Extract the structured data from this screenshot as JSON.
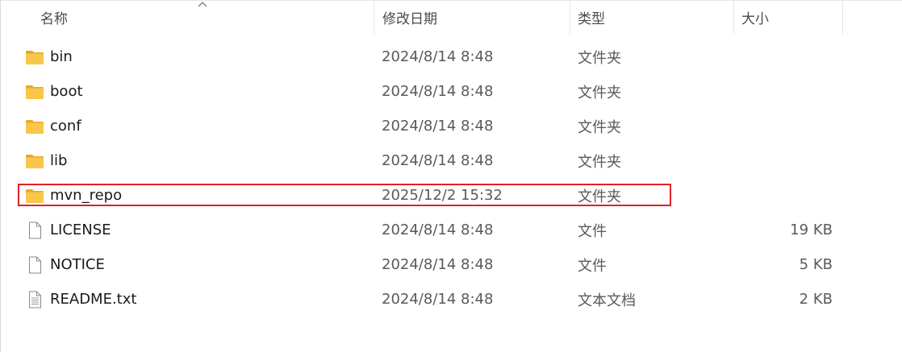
{
  "columns": {
    "name": "名称",
    "modified": "修改日期",
    "type": "类型",
    "size": "大小"
  },
  "files": [
    {
      "name": "bin",
      "modified": "2024/8/14 8:48",
      "type": "文件夹",
      "size": "",
      "icon": "folder-icon"
    },
    {
      "name": "boot",
      "modified": "2024/8/14 8:48",
      "type": "文件夹",
      "size": "",
      "icon": "folder-icon"
    },
    {
      "name": "conf",
      "modified": "2024/8/14 8:48",
      "type": "文件夹",
      "size": "",
      "icon": "folder-icon"
    },
    {
      "name": "lib",
      "modified": "2024/8/14 8:48",
      "type": "文件夹",
      "size": "",
      "icon": "folder-icon"
    },
    {
      "name": "mvn_repo",
      "modified": "2025/12/2 15:32",
      "type": "文件夹",
      "size": "",
      "icon": "folder-icon",
      "highlighted": true
    },
    {
      "name": "LICENSE",
      "modified": "2024/8/14 8:48",
      "type": "文件",
      "size": "19 KB",
      "icon": "file-icon"
    },
    {
      "name": "NOTICE",
      "modified": "2024/8/14 8:48",
      "type": "文件",
      "size": "5 KB",
      "icon": "file-icon"
    },
    {
      "name": "README.txt",
      "modified": "2024/8/14 8:48",
      "type": "文本文档",
      "size": "2 KB",
      "icon": "text-file-icon"
    }
  ],
  "colors": {
    "highlight": "#e0202a",
    "folder": "#f8c74a"
  }
}
